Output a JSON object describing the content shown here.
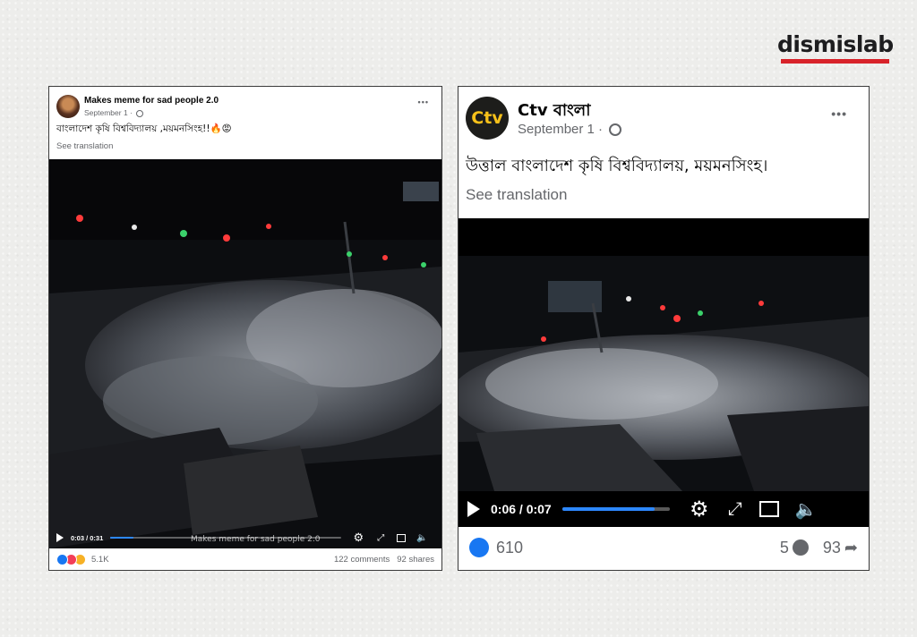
{
  "brand": {
    "name": "dismislab",
    "bar_color": "#d8232a"
  },
  "post_left": {
    "author": "Makes meme for sad people 2.0",
    "date": "September 1 ·",
    "privacy_icon": "globe-icon",
    "more_label": "•••",
    "text": "বাংলাদেশ কৃষি বিশ্ববিদ্যালয় ,ময়মনসিংহ!!🔥😡",
    "see_translation": "See translation",
    "video": {
      "time": "0:03 / 0:31",
      "progress": 0.1,
      "watermark": "Makes meme for sad people 2.0"
    },
    "reactions": {
      "icons": [
        "like-icon",
        "love-icon",
        "haha-icon"
      ],
      "count": "5.1K"
    },
    "comments": "122 comments",
    "shares": "92 shares"
  },
  "post_right": {
    "author": "Ctv বাংলা",
    "avatar_text": "Ctv",
    "date": "September 1 ·",
    "privacy_icon": "globe-icon",
    "more_label": "•••",
    "text": "উত্তাল বাংলাদেশ কৃষি বিশ্ববিদ্যালয়, ময়মনসিংহ।",
    "see_translation": "See translation",
    "video": {
      "time": "0:06 / 0:07",
      "progress": 0.86
    },
    "likes": "610",
    "comments": "5",
    "shares": "93",
    "colors": {
      "like": "#1877f2",
      "avatar_bg": "#1d1d1b",
      "avatar_text": "#f7c11a"
    }
  }
}
